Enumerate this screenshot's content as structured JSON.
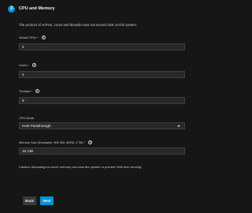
{
  "header": {
    "step_number": "3",
    "title": "CPU and Memory"
  },
  "hint": "The product of vCPUs, cores and threads must not exceed 255 on this system.",
  "fields": {
    "vcpus": {
      "label": "Virtual CPUs *",
      "value": "2"
    },
    "cores": {
      "label": "Cores *",
      "value": "4"
    },
    "threads": {
      "label": "Threads *",
      "value": "8"
    },
    "cpu_mode": {
      "label": "CPU Mode",
      "value": "Host Passthrough"
    },
    "memory": {
      "label": "Memory Size (Examples: 500 KiB, 500M, 2 TB) *",
      "value": "16 GiB"
    }
  },
  "help_glyph": "?",
  "caution": "Caution: Allocating too much memory can slow the system or prevent VMs from running.",
  "buttons": {
    "back": "Back",
    "next": "Next"
  },
  "colors": {
    "accent": "#0095d5",
    "background": "#161616",
    "input_bg": "#282828"
  },
  "icons": {
    "help": "help-circle-icon",
    "dropdown": "chevron-down-icon"
  }
}
